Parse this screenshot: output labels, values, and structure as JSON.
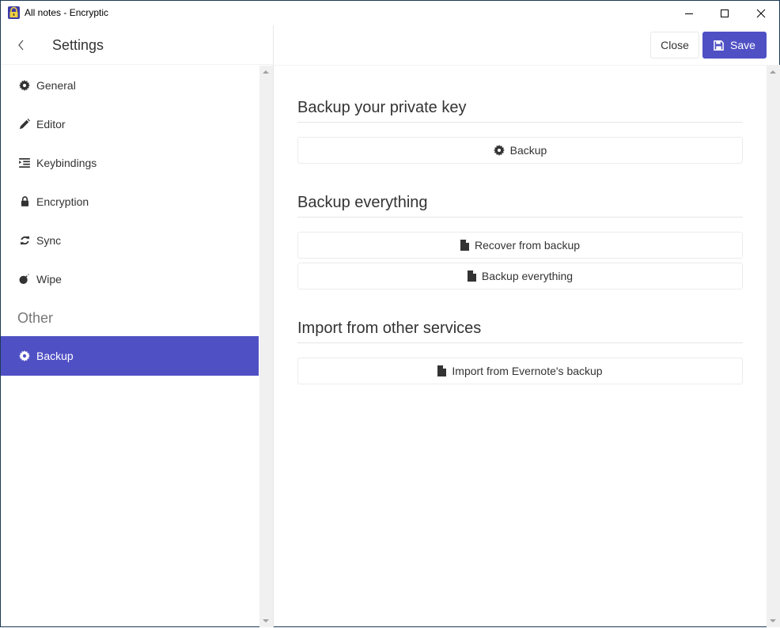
{
  "window": {
    "title": "All notes - Encryptic",
    "controls": [
      "minimize",
      "maximize",
      "close"
    ]
  },
  "colors": {
    "accent": "#5050c5",
    "section_label": "#777777",
    "text": "#333333"
  },
  "header": {
    "back_icon": "chevron-left-icon",
    "title": "Settings"
  },
  "toolbar": {
    "close_label": "Close",
    "save_label": "Save",
    "save_icon": "floppy-disk-icon"
  },
  "sidebar": {
    "items": [
      {
        "label": "General",
        "icon": "gear-icon"
      },
      {
        "label": "Editor",
        "icon": "pencil-icon"
      },
      {
        "label": "Keybindings",
        "icon": "indent-list-icon"
      },
      {
        "label": "Encryption",
        "icon": "lock-icon"
      },
      {
        "label": "Sync",
        "icon": "refresh-icon"
      },
      {
        "label": "Wipe",
        "icon": "bomb-icon"
      }
    ],
    "section_other": "Other",
    "other_items": [
      {
        "label": "Backup",
        "icon": "gear-icon",
        "active": true
      }
    ]
  },
  "main": {
    "sections": [
      {
        "title": "Backup your private key",
        "buttons": [
          {
            "label": "Backup",
            "icon": "gear-icon"
          }
        ]
      },
      {
        "title": "Backup everything",
        "buttons": [
          {
            "label": "Recover from backup",
            "icon": "file-icon"
          },
          {
            "label": "Backup everything",
            "icon": "file-icon"
          }
        ]
      },
      {
        "title": "Import from other services",
        "buttons": [
          {
            "label": "Import from Evernote's backup",
            "icon": "file-icon"
          }
        ]
      }
    ]
  }
}
